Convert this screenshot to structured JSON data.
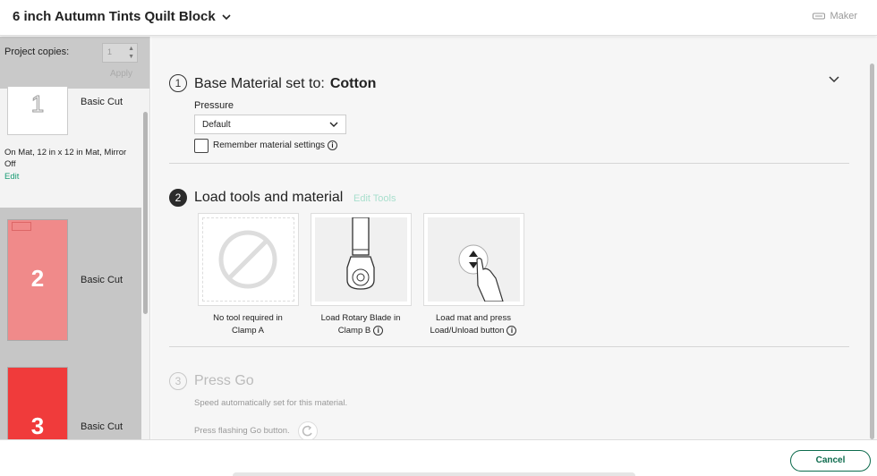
{
  "header": {
    "title": "6 inch Autumn Tints Quilt Block",
    "maker_label": "Maker"
  },
  "sidebar": {
    "copies_label": "Project copies:",
    "copies_value": "1",
    "apply_label": "Apply",
    "mats": [
      {
        "number": "1",
        "label": "Basic Cut",
        "color": "#ffffff"
      },
      {
        "number": "2",
        "label": "Basic Cut",
        "color": "#f08a8a"
      },
      {
        "number": "3",
        "label": "Basic Cut",
        "color": "#f03b3b"
      }
    ],
    "mat_info": "On Mat, 12 in x 12 in Mat, Mirror Off",
    "edit_label": "Edit"
  },
  "steps": {
    "step1": {
      "number": "1",
      "title": "Base Material set to:",
      "material": "Cotton",
      "pressure_label": "Pressure",
      "pressure_value": "Default",
      "remember_label": "Remember material settings"
    },
    "step2": {
      "number": "2",
      "title": "Load tools and material",
      "edit_tools_label": "Edit Tools",
      "cards": [
        {
          "line1": "No tool required in",
          "line2": "Clamp A"
        },
        {
          "line1": "Load Rotary Blade in",
          "line2": "Clamp B"
        },
        {
          "line1": "Load mat and press",
          "line2": "Load/Unload button"
        }
      ]
    },
    "step3": {
      "number": "3",
      "title": "Press Go",
      "subtitle": "Speed automatically set for this material.",
      "press_text": "Press flashing Go button."
    }
  },
  "footer": {
    "cancel_label": "Cancel"
  },
  "colors": {
    "accent": "#0d6b4d",
    "edit_link": "#1a9c74"
  }
}
